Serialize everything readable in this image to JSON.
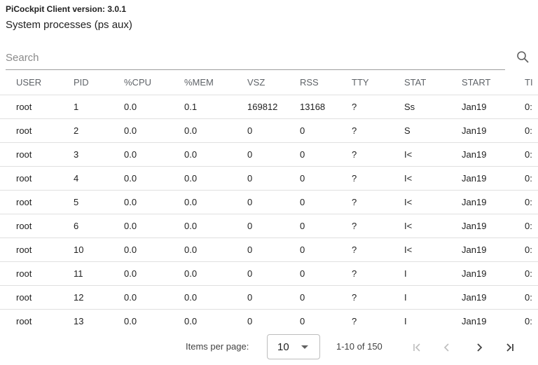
{
  "header": {
    "version_text": "PiCockpit Client version: 3.0.1",
    "subtitle": "System processes (ps aux)"
  },
  "search": {
    "placeholder": "Search",
    "value": "",
    "icon": "search-icon"
  },
  "table": {
    "columns": [
      "USER",
      "PID",
      "%CPU",
      "%MEM",
      "VSZ",
      "RSS",
      "TTY",
      "STAT",
      "START",
      "TI"
    ],
    "rows": [
      [
        "root",
        "1",
        "0.0",
        "0.1",
        "169812",
        "13168",
        "?",
        "Ss",
        "Jan19",
        "0:"
      ],
      [
        "root",
        "2",
        "0.0",
        "0.0",
        "0",
        "0",
        "?",
        "S",
        "Jan19",
        "0:"
      ],
      [
        "root",
        "3",
        "0.0",
        "0.0",
        "0",
        "0",
        "?",
        "I<",
        "Jan19",
        "0:"
      ],
      [
        "root",
        "4",
        "0.0",
        "0.0",
        "0",
        "0",
        "?",
        "I<",
        "Jan19",
        "0:"
      ],
      [
        "root",
        "5",
        "0.0",
        "0.0",
        "0",
        "0",
        "?",
        "I<",
        "Jan19",
        "0:"
      ],
      [
        "root",
        "6",
        "0.0",
        "0.0",
        "0",
        "0",
        "?",
        "I<",
        "Jan19",
        "0:"
      ],
      [
        "root",
        "10",
        "0.0",
        "0.0",
        "0",
        "0",
        "?",
        "I<",
        "Jan19",
        "0:"
      ],
      [
        "root",
        "11",
        "0.0",
        "0.0",
        "0",
        "0",
        "?",
        "I",
        "Jan19",
        "0:"
      ],
      [
        "root",
        "12",
        "0.0",
        "0.0",
        "0",
        "0",
        "?",
        "I",
        "Jan19",
        "0:"
      ],
      [
        "root",
        "13",
        "0.0",
        "0.0",
        "0",
        "0",
        "?",
        "I",
        "Jan19",
        "0:"
      ]
    ]
  },
  "paginator": {
    "items_per_page_label": "Items per page:",
    "items_per_page_value": "10",
    "range_label": "1-10 of 150",
    "buttons": [
      {
        "name": "first-page-button",
        "icon": "first-page-icon",
        "enabled": false
      },
      {
        "name": "previous-page-button",
        "icon": "chevron-left-icon",
        "enabled": false
      },
      {
        "name": "next-page-button",
        "icon": "chevron-right-icon",
        "enabled": true
      },
      {
        "name": "last-page-button",
        "icon": "last-page-icon",
        "enabled": true
      }
    ]
  },
  "colors": {
    "text": "#212121",
    "header_text": "#5f6368",
    "divider": "#e0e0e0",
    "disabled_icon": "#bdbdbd",
    "enabled_icon": "#424242"
  }
}
